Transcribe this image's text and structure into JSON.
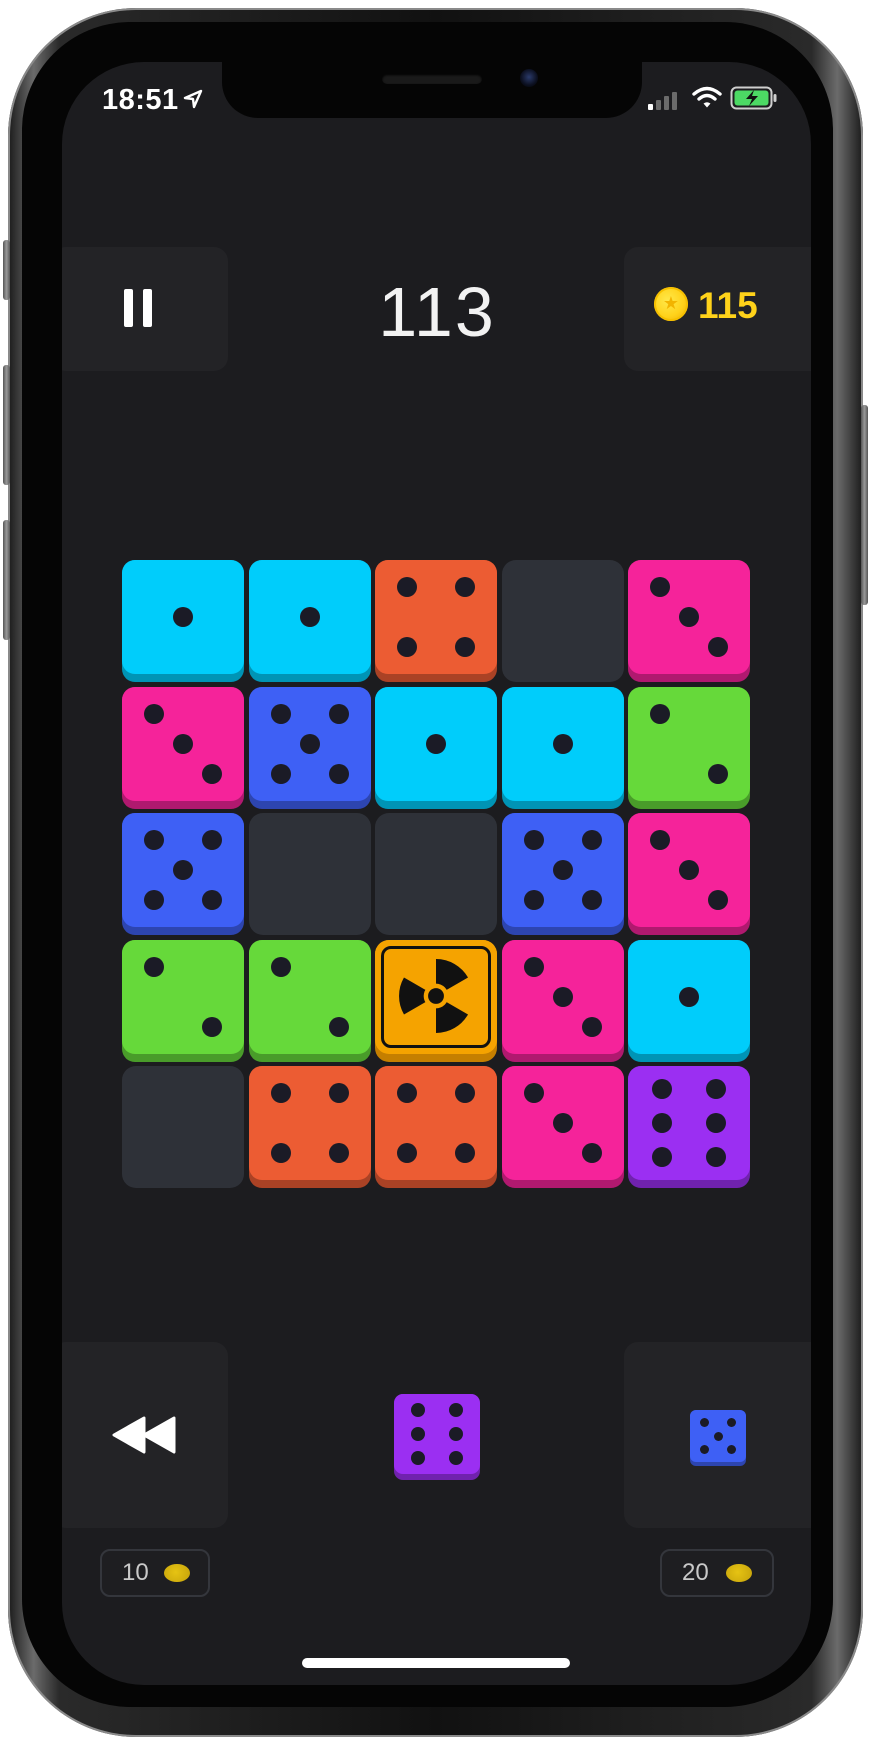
{
  "status_bar": {
    "time": "18:51",
    "location_icon": "location-arrow-icon",
    "signal_icon": "cellular-signal-icon",
    "wifi_icon": "wifi-icon",
    "battery_icon": "battery-charging-icon"
  },
  "header": {
    "pause_icon": "pause-icon",
    "score": "113",
    "coins": "115",
    "coin_icon": "coin-icon"
  },
  "board": {
    "rows": [
      [
        {
          "type": "die",
          "color": "#00cdfb",
          "pips": 1
        },
        {
          "type": "die",
          "color": "#00cdfb",
          "pips": 1
        },
        {
          "type": "die",
          "color": "#ec5c33",
          "pips": 4
        },
        {
          "type": "empty"
        },
        {
          "type": "die",
          "color": "#f5239a",
          "pips": 3
        }
      ],
      [
        {
          "type": "die",
          "color": "#f5239a",
          "pips": 3
        },
        {
          "type": "die",
          "color": "#3e60f5",
          "pips": 5
        },
        {
          "type": "die",
          "color": "#00cdfb",
          "pips": 1
        },
        {
          "type": "die",
          "color": "#00cdfb",
          "pips": 1
        },
        {
          "type": "die",
          "color": "#66d93a",
          "pips": 2
        }
      ],
      [
        {
          "type": "die",
          "color": "#3e60f5",
          "pips": 5
        },
        {
          "type": "empty"
        },
        {
          "type": "empty"
        },
        {
          "type": "die",
          "color": "#3e60f5",
          "pips": 5
        },
        {
          "type": "die",
          "color": "#f5239a",
          "pips": 3
        }
      ],
      [
        {
          "type": "die",
          "color": "#66d93a",
          "pips": 2
        },
        {
          "type": "die",
          "color": "#66d93a",
          "pips": 2
        },
        {
          "type": "hazard",
          "icon": "radiation-icon"
        },
        {
          "type": "die",
          "color": "#f5239a",
          "pips": 3
        },
        {
          "type": "die",
          "color": "#00cdfb",
          "pips": 1
        }
      ],
      [
        {
          "type": "empty"
        },
        {
          "type": "die",
          "color": "#ec5c33",
          "pips": 4
        },
        {
          "type": "die",
          "color": "#ec5c33",
          "pips": 4
        },
        {
          "type": "die",
          "color": "#f5239a",
          "pips": 3
        },
        {
          "type": "die",
          "color": "#9b2ff2",
          "pips": 6
        }
      ]
    ]
  },
  "footer": {
    "undo_icon": "rewind-icon",
    "undo_price": "10",
    "next_piece": {
      "color": "#9b2ff2",
      "pips": 6
    },
    "swap_piece": {
      "color": "#3e60f5",
      "pips": 5
    },
    "swap_price": "20"
  }
}
